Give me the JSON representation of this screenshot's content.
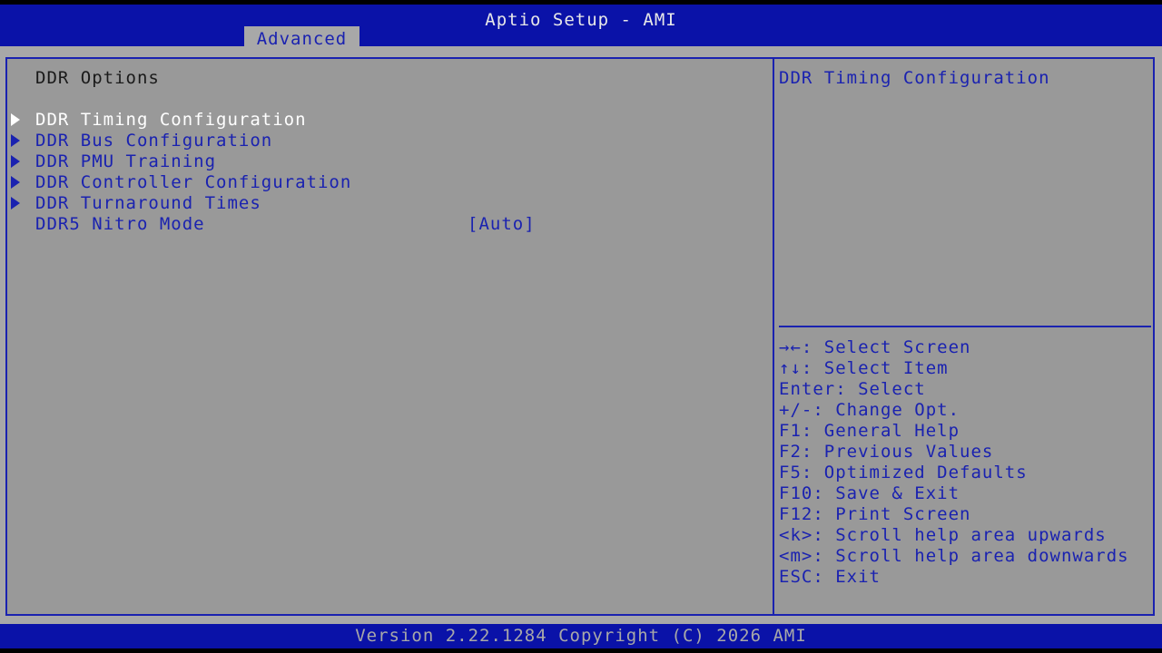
{
  "app": {
    "title": "Aptio Setup - AMI",
    "active_tab": "Advanced",
    "version": "Version 2.22.1284 Copyright (C) 2026 AMI"
  },
  "colors": {
    "title_bar": "#0a12a8",
    "panel_bg": "#999999",
    "frame_blue": "#1a22b0",
    "selected_text": "#ffffff"
  },
  "main": {
    "section_title": "DDR Options",
    "submenus": [
      {
        "label": "DDR Timing Configuration",
        "selected": true
      },
      {
        "label": "DDR Bus Configuration",
        "selected": false
      },
      {
        "label": "DDR PMU Training",
        "selected": false
      },
      {
        "label": "DDR Controller Configuration",
        "selected": false
      },
      {
        "label": "DDR Turnaround Times",
        "selected": false
      }
    ],
    "options": [
      {
        "label": "DDR5 Nitro Mode",
        "value": "[Auto]"
      }
    ]
  },
  "help": {
    "description": "DDR Timing Configuration",
    "keys": [
      "→←: Select Screen",
      "↑↓: Select Item",
      "Enter: Select",
      "+/-: Change Opt.",
      "F1: General Help",
      "F2: Previous Values",
      "F5: Optimized Defaults",
      "F10: Save & Exit",
      "F12: Print Screen",
      "<k>: Scroll help area upwards",
      "<m>: Scroll help area downwards",
      "ESC: Exit"
    ]
  }
}
